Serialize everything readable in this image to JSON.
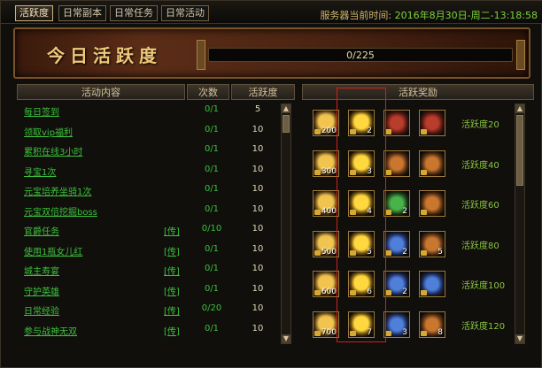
{
  "tabs": [
    "活跃度",
    "日常副本",
    "日常任务",
    "日常活动"
  ],
  "active_tab_index": 0,
  "server_time": {
    "label": "服务器当前时间:",
    "value": "2016年8月30日-周二-13:18:58"
  },
  "banner": {
    "title": "今日活跃度",
    "progress_text": "0/225",
    "progress_value": 0
  },
  "left_headers": {
    "content": "活动内容",
    "count": "次数",
    "score": "活跃度"
  },
  "activities": [
    {
      "name": "每日签到",
      "tag": "",
      "count": "0/1",
      "score": "5"
    },
    {
      "name": "领取vip福利",
      "tag": "",
      "count": "0/1",
      "score": "10"
    },
    {
      "name": "累积在线3小时",
      "tag": "",
      "count": "0/1",
      "score": "10"
    },
    {
      "name": "寻宝1次",
      "tag": "",
      "count": "0/1",
      "score": "10"
    },
    {
      "name": "元宝培养坐骑1次",
      "tag": "",
      "count": "0/1",
      "score": "10"
    },
    {
      "name": "元宝双倍挖掘boss",
      "tag": "",
      "count": "0/1",
      "score": "10"
    },
    {
      "name": "官爵任务",
      "tag": "[传]",
      "count": "0/10",
      "score": "10"
    },
    {
      "name": "使用1瓶女儿红",
      "tag": "[传]",
      "count": "0/1",
      "score": "10"
    },
    {
      "name": "城主寿宴",
      "tag": "[传]",
      "count": "0/1",
      "score": "10"
    },
    {
      "name": "守护英雄",
      "tag": "[传]",
      "count": "0/1",
      "score": "10"
    },
    {
      "name": "日常经验",
      "tag": "[传]",
      "count": "0/20",
      "score": "10"
    },
    {
      "name": "参与战神无双",
      "tag": "[传]",
      "count": "0/1",
      "score": "10"
    }
  ],
  "right_header": "活跃奖励",
  "rewards": [
    {
      "label": "活跃度20",
      "items": [
        {
          "type": "gold",
          "qty": "200"
        },
        {
          "type": "coin",
          "qty": "2"
        },
        {
          "type": "red",
          "qty": ""
        },
        {
          "type": "red",
          "qty": ""
        }
      ]
    },
    {
      "label": "活跃度40",
      "items": [
        {
          "type": "gold",
          "qty": "300"
        },
        {
          "type": "coin",
          "qty": "3"
        },
        {
          "type": "orange",
          "qty": ""
        },
        {
          "type": "orange",
          "qty": ""
        }
      ]
    },
    {
      "label": "活跃度60",
      "items": [
        {
          "type": "gold",
          "qty": "400"
        },
        {
          "type": "coin",
          "qty": "4"
        },
        {
          "type": "green",
          "qty": "2"
        },
        {
          "type": "orange",
          "qty": ""
        }
      ]
    },
    {
      "label": "活跃度80",
      "items": [
        {
          "type": "gold",
          "qty": "500"
        },
        {
          "type": "coin",
          "qty": "5"
        },
        {
          "type": "blue",
          "qty": "2"
        },
        {
          "type": "orange",
          "qty": "5"
        }
      ]
    },
    {
      "label": "活跃度100",
      "items": [
        {
          "type": "gold",
          "qty": "600"
        },
        {
          "type": "coin",
          "qty": "6"
        },
        {
          "type": "blue",
          "qty": "2"
        },
        {
          "type": "blue",
          "qty": ""
        }
      ]
    },
    {
      "label": "活跃度120",
      "items": [
        {
          "type": "gold",
          "qty": "700"
        },
        {
          "type": "coin",
          "qty": "7"
        },
        {
          "type": "blue",
          "qty": "3"
        },
        {
          "type": "orange",
          "qty": "8"
        }
      ]
    }
  ],
  "icons": {
    "scroll_up": "▲",
    "scroll_down": "▼"
  },
  "colors": {
    "accent_green": "#3cc13c",
    "highlight": "#d11f1f",
    "banner_title": "#f0c97a"
  }
}
